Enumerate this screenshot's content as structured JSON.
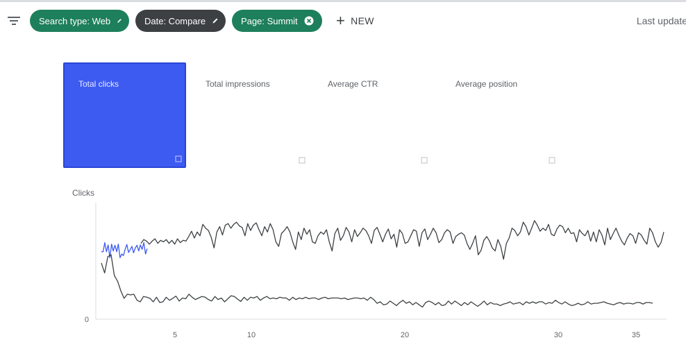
{
  "toolbar": {
    "chips": [
      {
        "label": "Search type: Web",
        "style": "green",
        "icon": "pencil-icon"
      },
      {
        "label": "Date: Compare",
        "style": "dark",
        "icon": "pencil-icon"
      },
      {
        "label": "Page: Summit",
        "style": "green",
        "icon": "close-circle-icon"
      }
    ],
    "new_label": "NEW",
    "last_update": "Last update"
  },
  "metrics": [
    {
      "label": "Total clicks",
      "value": "",
      "active": true
    },
    {
      "label": "Total impressions",
      "value": "",
      "active": false
    },
    {
      "label": "Average CTR",
      "value": "",
      "active": false
    },
    {
      "label": "Average position",
      "value": "",
      "active": false
    }
  ],
  "colors": {
    "active_card": "#3d5af1",
    "chip_green": "#1e7f5c",
    "chip_dark": "#3c4043",
    "series_primary": "#3d5af1",
    "series_compare": "#3c4043"
  },
  "chart": {
    "y_title": "Clicks",
    "y_ticks": [
      "",
      "",
      "",
      "0"
    ],
    "x_ticks": [
      "5",
      "10",
      "",
      "20",
      "",
      "30",
      "35"
    ]
  },
  "chart_data": {
    "type": "line",
    "ylabel": "Clicks",
    "ylim": [
      0,
      3
    ],
    "grid": false,
    "series": [
      {
        "values": [
          1.78,
          1.78,
          2.02,
          1.78,
          1.96,
          1.62,
          1.98,
          1.8,
          1.95,
          1.78,
          1.98,
          1.62,
          1.72,
          1.68,
          1.84,
          1.97,
          1.76,
          1.84,
          1.92,
          1.75,
          1.88,
          1.95,
          1.8,
          1.96,
          1.84,
          2.02,
          1.72,
          1.86
        ]
      },
      {
        "values": [
          1.48,
          1.22,
          1.65,
          1.7,
          1.15,
          1.0,
          0.75,
          0.55,
          0.66,
          0.64,
          0.66,
          0.5,
          0.46,
          0.6,
          0.58,
          0.55,
          0.46,
          0.58,
          0.44,
          0.46,
          0.58,
          0.5,
          0.55,
          0.61,
          0.48,
          0.56,
          0.54,
          0.66,
          0.58,
          0.52,
          0.56,
          0.6,
          0.58,
          0.52,
          0.48,
          0.6,
          0.52,
          0.56,
          0.46,
          0.54,
          0.62,
          0.6,
          0.53,
          0.47,
          0.58,
          0.5,
          0.58,
          0.56,
          0.6,
          0.5,
          0.56,
          0.6,
          0.54,
          0.56,
          0.54,
          0.58,
          0.56,
          0.56,
          0.5,
          0.58,
          0.52,
          0.56,
          0.54,
          0.58,
          0.54,
          0.56,
          0.56,
          0.52,
          0.56,
          0.58,
          0.54,
          0.56,
          0.56,
          0.56,
          0.54,
          0.56,
          0.52,
          0.54,
          0.56,
          0.56,
          0.54,
          0.56,
          0.5,
          0.58,
          0.52,
          0.42,
          0.46,
          0.38,
          0.4,
          0.48,
          0.42,
          0.36,
          0.44,
          0.5,
          0.42,
          0.46,
          0.38,
          0.44,
          0.38,
          0.32,
          0.44,
          0.48,
          0.44,
          0.38,
          0.44,
          0.36,
          0.38,
          0.48,
          0.4,
          0.48,
          0.42,
          0.36,
          0.44,
          0.38,
          0.46,
          0.4,
          0.34,
          0.4,
          0.48,
          0.38,
          0.44,
          0.4,
          0.4,
          0.36,
          0.4,
          0.42,
          0.46,
          0.4,
          0.42,
          0.44,
          0.38,
          0.46,
          0.42,
          0.46,
          0.42,
          0.46,
          0.46,
          0.4,
          0.44,
          0.42,
          0.5,
          0.44,
          0.4,
          0.46,
          0.4,
          0.36,
          0.38,
          0.42,
          0.38,
          0.4,
          0.46,
          0.4,
          0.42,
          0.42,
          0.44,
          0.46,
          0.42,
          0.4,
          0.38,
          0.42,
          0.44,
          0.4,
          0.42,
          0.42,
          0.4,
          0.44,
          0.44,
          0.4,
          0.44,
          0.44,
          0.42
        ]
      },
      {
        "values": [
          2.0,
          2.1,
          2.06,
          1.98,
          2.06,
          2.12,
          2.0,
          2.08,
          2.04,
          2.1,
          2.0,
          2.08,
          1.98,
          2.12,
          2.02,
          2.08,
          2.06,
          2.18,
          2.32,
          2.14,
          2.3,
          2.2,
          2.5,
          2.4,
          2.34,
          2.16,
          1.88,
          2.3,
          2.44,
          2.22,
          2.48,
          2.52,
          2.4,
          2.5,
          2.56,
          2.46,
          2.42,
          2.2,
          2.52,
          2.34,
          2.48,
          2.54,
          2.36,
          2.2,
          2.44,
          2.3,
          2.52,
          2.36,
          2.04,
          1.92,
          2.26,
          2.34,
          2.44,
          2.3,
          2.04,
          1.84,
          2.3,
          2.1,
          2.4,
          2.24,
          2.36,
          2.04,
          2.0,
          2.2,
          2.3,
          2.24,
          2.36,
          2.04,
          1.8,
          2.26,
          2.4,
          2.08,
          2.2,
          2.42,
          2.3,
          2.04,
          2.36,
          2.18,
          2.28,
          2.4,
          2.34,
          2.2,
          2.0,
          2.34,
          2.42,
          2.24,
          2.04,
          2.24,
          2.38,
          2.12,
          2.24,
          1.9,
          2.36,
          2.26,
          2.0,
          2.04,
          2.2,
          2.36,
          2.32,
          1.92,
          2.28,
          2.38,
          2.1,
          2.24,
          2.4,
          2.28,
          2.02,
          2.1,
          2.28,
          2.36,
          2.3,
          2.0,
          2.18,
          2.24,
          2.28,
          2.22,
          2.0,
          1.84,
          2.0,
          2.2,
          1.7,
          1.82,
          2.08,
          2.18,
          2.06,
          1.88,
          1.8,
          2.1,
          1.92,
          1.58,
          2.0,
          2.14,
          2.4,
          2.34,
          2.2,
          2.3,
          2.56,
          2.44,
          2.22,
          2.4,
          2.6,
          2.48,
          2.32,
          2.4,
          2.34,
          2.5,
          2.24,
          2.2,
          2.38,
          2.48,
          2.44,
          2.28,
          2.4,
          2.26,
          2.28,
          2.04,
          2.36,
          2.26,
          2.2,
          2.34,
          2.06,
          2.3,
          2.04,
          2.36,
          2.22,
          1.96,
          2.4,
          2.1,
          2.26,
          2.4,
          2.22,
          2.06,
          1.96,
          2.14,
          2.26,
          2.2,
          2.0,
          2.28,
          2.22,
          2.08,
          1.98,
          2.4,
          2.28,
          2.04,
          1.9,
          2.02,
          2.3
        ]
      }
    ]
  }
}
